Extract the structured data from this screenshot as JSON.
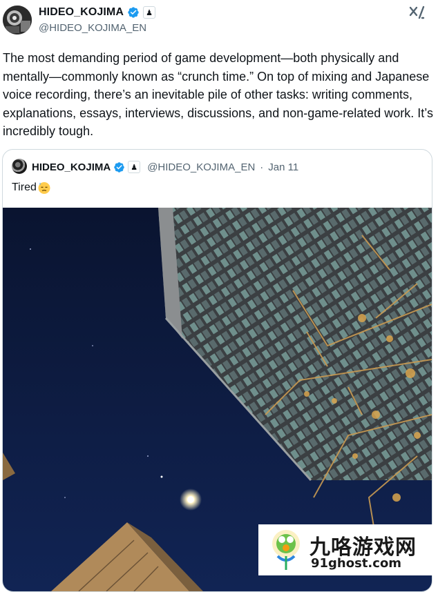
{
  "author": {
    "display_name": "HIDEO_KOJIMA",
    "handle": "@HIDEO_KOJIMA_EN",
    "affiliate_badge": "♟"
  },
  "post": {
    "text": "The most demanding period of game development—both physically and mentally—commonly known as “crunch time.” On top of mixing and Japanese voice recording, there’s an inevitable pile of other tasks: writing comments, explanations, essays, interviews, discussions, and non-game-related work. It’s incredibly tough."
  },
  "quoted_post": {
    "display_name": "HIDEO_KOJIMA",
    "handle": "@HIDEO_KOJIMA_EN",
    "separator": "·",
    "date": "Jan 11",
    "text": "Tired",
    "emoji": "downcast-sweat-face-emoji"
  },
  "watermark": {
    "title": "九咯游戏网",
    "url": "91ghost.com"
  },
  "colors": {
    "verified_blue": "#1d9bf0",
    "secondary_text": "#536471",
    "border": "#cfd9de",
    "night_sky": "#0d1a3c"
  },
  "icons": [
    "verified-badge-icon",
    "affiliate-badge-icon",
    "grok-icon"
  ]
}
